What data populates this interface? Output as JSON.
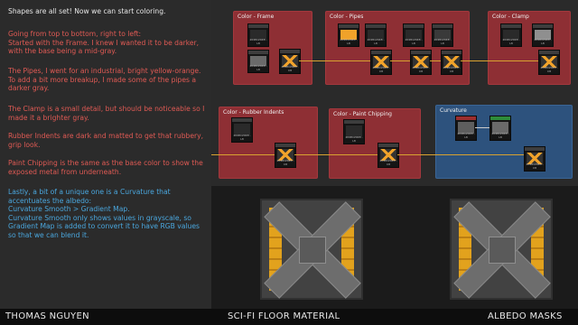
{
  "text_panel": {
    "intro": "Shapes are all set! Now we can start coloring.",
    "frame_note": "Going from top to bottom, right to left:\nStarted with the Frame. I knew I wanted it to be darker, with the base being a mid-gray.",
    "pipes_note": "The Pipes, I went for an industrial, bright yellow-orange. To add a bit more breakup, I made some of the pipes a darker gray.",
    "clamp_note": "The Clamp is a small detail, but should be noticeable so I made it a brighter gray.",
    "rubber_note": "Rubber Indents are dark and matted to get that rubbery, grip look.",
    "chipping_note": "Paint Chipping is the same as the base color to show the exposed metal from underneath.",
    "curvature_note": "Lastly, a bit of a unique one is a Curvature that accentuates the albedo:\nCurvature Smooth > Gradient Map.\nCurvature Smooth only shows values in grayscale, so Gradient Map is added to convert it to have RGB values so that we can blend it."
  },
  "graph": {
    "frames": {
      "frame": "Color - Frame",
      "pipes": "Color - Pipes",
      "clamp": "Color - Clamp",
      "rubber": "Color - Rubber Indents",
      "chipping": "Color - Paint Chipping",
      "curvature": "Curvature"
    },
    "node_resolution": "2048x2048 - L8",
    "node_resolution_rgba": "2048x2048 - C8"
  },
  "footer": {
    "author": "THOMAS NGUYEN",
    "title": "SCI-FI FLOOR MATERIAL",
    "section": "ALBEDO MASKS"
  },
  "colors": {
    "red_frame": "#8e2f34",
    "blue_frame": "#2d527d",
    "red_text": "#e05a54",
    "blue_text": "#4aa7de",
    "pipe_yellow": "#e2a21d"
  }
}
